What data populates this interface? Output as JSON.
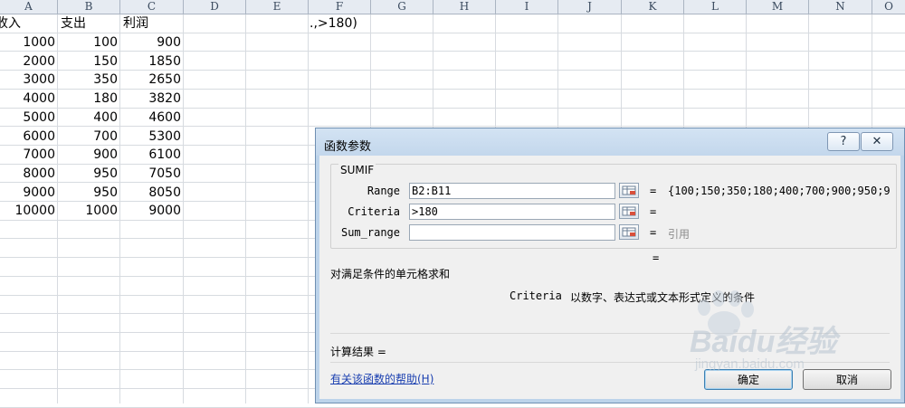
{
  "sheet": {
    "columns": [
      "A",
      "B",
      "C",
      "D",
      "E",
      "F",
      "G",
      "H",
      "I",
      "J",
      "K",
      "L",
      "M",
      "N",
      "O"
    ],
    "headers": [
      "收入",
      "支出",
      "利润"
    ],
    "rows": [
      [
        "1000",
        "100",
        "900"
      ],
      [
        "2000",
        "150",
        "1850"
      ],
      [
        "3000",
        "350",
        "2650"
      ],
      [
        "4000",
        "180",
        "3820"
      ],
      [
        "5000",
        "400",
        "4600"
      ],
      [
        "6000",
        "700",
        "5300"
      ],
      [
        "7000",
        "900",
        "6100"
      ],
      [
        "8000",
        "950",
        "7050"
      ],
      [
        "9000",
        "950",
        "8050"
      ],
      [
        "10000",
        "1000",
        "9000"
      ]
    ],
    "f1_text": ".,>180)"
  },
  "dialog": {
    "title": "函数参数",
    "help_glyph": "?",
    "close_glyph": "✕",
    "function_name": "SUMIF",
    "params": [
      {
        "label": "Range",
        "value": "B2:B11",
        "eq": "=",
        "result": "{100;150;350;180;400;700;900;950;9"
      },
      {
        "label": "Criteria",
        "value": ">180",
        "eq": "=",
        "result": ""
      },
      {
        "label": "Sum_range",
        "value": "",
        "eq": "=",
        "result": "引用"
      }
    ],
    "total_eq": "=",
    "description": "对满足条件的单元格求和",
    "param_name": "Criteria",
    "param_desc": "以数字、表达式或文本形式定义的条件",
    "calc_result_label": "计算结果 =",
    "help_link": "有关该函数的帮助(H)",
    "ok_label": "确定",
    "cancel_label": "取消"
  },
  "watermark": {
    "logo_text": "Baidu经验",
    "url_text": "jingyan.baidu.com"
  }
}
